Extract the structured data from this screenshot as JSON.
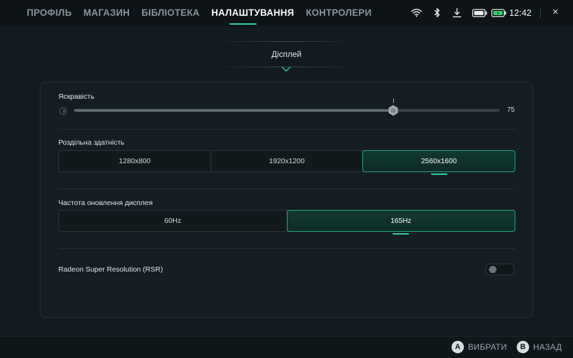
{
  "nav": {
    "tabs": [
      {
        "label": "ПРОФІЛЬ"
      },
      {
        "label": "МАГАЗИН"
      },
      {
        "label": "БІБЛІОТЕКА"
      },
      {
        "label": "НАЛАШТУВАННЯ"
      },
      {
        "label": "КОНТРОЛЕРИ"
      }
    ],
    "active_tab": "НАЛАШТУВАННЯ"
  },
  "status": {
    "icons": [
      "wifi-icon",
      "bluetooth-icon",
      "download-icon",
      "controller-battery-icon",
      "battery-icon"
    ],
    "time": "12:42",
    "close": "×"
  },
  "section": {
    "title": "Дісплей"
  },
  "brightness": {
    "label": "Яскравість",
    "value": "75",
    "level_percent": 75
  },
  "resolution": {
    "label": "Роздільна здатність",
    "options": [
      "1280x800",
      "1920x1200",
      "2560x1600"
    ],
    "selected": "2560x1600"
  },
  "refresh_rate": {
    "label": "Частота оновлення дисплея",
    "options": [
      "60Hz",
      "165Hz"
    ],
    "selected": "165Hz"
  },
  "rsr": {
    "label": "Radeon Super Resolution (RSR)",
    "enabled": false
  },
  "footer": {
    "select_key": "A",
    "select_label": "ВИБРАТИ",
    "back_key": "B",
    "back_label": "НАЗАД"
  },
  "colors": {
    "accent": "#2fd6a4",
    "background": "#121a1f",
    "selected_bg": "#103a30"
  }
}
